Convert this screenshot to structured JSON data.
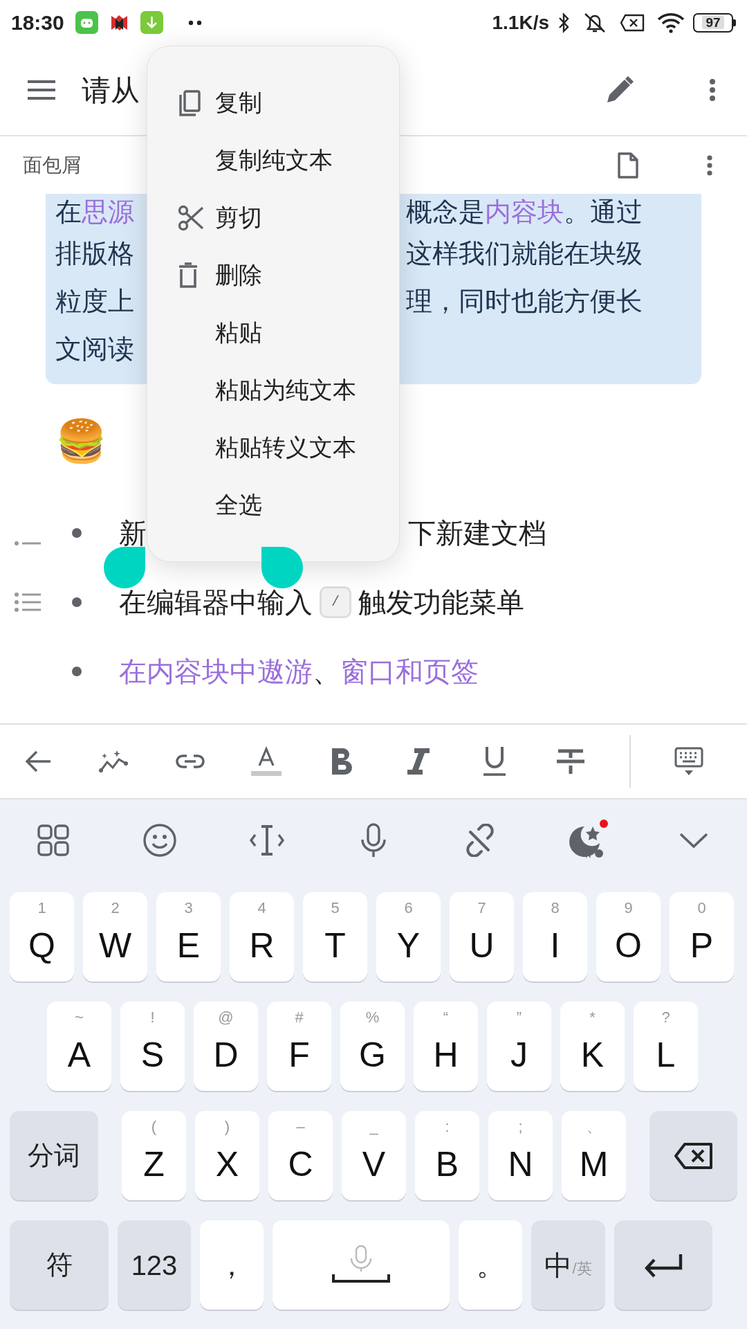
{
  "status_bar": {
    "time": "18:30",
    "net_speed": "1.1K/s",
    "battery": "97"
  },
  "app_bar": {
    "title": "请从"
  },
  "breadcrumb": {
    "label": "面包屑"
  },
  "callout": {
    "lines": [
      {
        "left": [
          {
            "kind": "text",
            "text": "在"
          },
          {
            "kind": "link",
            "text": "思源"
          }
        ],
        "right": [
          {
            "kind": "text",
            "text": "概念是"
          },
          {
            "kind": "link",
            "text": "内容块"
          },
          {
            "kind": "text",
            "text": "。通过"
          }
        ]
      },
      {
        "left": [
          {
            "kind": "text",
            "text": "排版格"
          }
        ],
        "right": [
          {
            "kind": "text",
            "text": "这样我们就能在块级"
          }
        ]
      },
      {
        "left": [
          {
            "kind": "text",
            "text": "粒度上"
          }
        ],
        "right": [
          {
            "kind": "text",
            "text": "理，同时也能方便长"
          }
        ]
      },
      {
        "left": [
          {
            "kind": "text",
            "text": "文阅读"
          }
        ]
      }
    ]
  },
  "heading": {
    "emoji": "🍔"
  },
  "bullets": [
    {
      "left": [
        {
          "kind": "text",
          "text": "新"
        }
      ],
      "right": [
        {
          "kind": "text",
          "text": "下新建文档"
        }
      ]
    },
    {
      "left": [
        {
          "kind": "text",
          "text": "在编辑器中输入"
        },
        {
          "kind": "kbd",
          "text": "/"
        },
        {
          "kind": "text",
          "text": "触发功能菜单"
        }
      ]
    },
    {
      "left": [
        {
          "kind": "link",
          "text": "在内容块中遨游"
        },
        {
          "kind": "text",
          "text": "、"
        },
        {
          "kind": "link",
          "text": "窗口和页签"
        }
      ]
    }
  ],
  "context_menu": [
    {
      "kind": "copy",
      "label": "复制"
    },
    {
      "kind": "plain",
      "label": "复制纯文本"
    },
    {
      "kind": "cut",
      "label": "剪切"
    },
    {
      "kind": "delete",
      "label": "删除"
    },
    {
      "kind": "plain",
      "label": "粘贴"
    },
    {
      "kind": "plain",
      "label": "粘贴为纯文本"
    },
    {
      "kind": "plain",
      "label": "粘贴转义文本"
    },
    {
      "kind": "plain",
      "label": "全选"
    }
  ],
  "keyboard": {
    "rows": [
      [
        {
          "kind": "letter",
          "label": "Q",
          "hint": "1"
        },
        {
          "kind": "letter",
          "label": "W",
          "hint": "2"
        },
        {
          "kind": "letter",
          "label": "E",
          "hint": "3"
        },
        {
          "kind": "letter",
          "label": "R",
          "hint": "4"
        },
        {
          "kind": "letter",
          "label": "T",
          "hint": "5"
        },
        {
          "kind": "letter",
          "label": "Y",
          "hint": "6"
        },
        {
          "kind": "letter",
          "label": "U",
          "hint": "7"
        },
        {
          "kind": "letter",
          "label": "I",
          "hint": "8"
        },
        {
          "kind": "letter",
          "label": "O",
          "hint": "9"
        },
        {
          "kind": "letter",
          "label": "P",
          "hint": "0"
        }
      ],
      [
        {
          "kind": "letter",
          "label": "A",
          "hint": "~"
        },
        {
          "kind": "letter",
          "label": "S",
          "hint": "!"
        },
        {
          "kind": "letter",
          "label": "D",
          "hint": "@"
        },
        {
          "kind": "letter",
          "label": "F",
          "hint": "#"
        },
        {
          "kind": "letter",
          "label": "G",
          "hint": "%"
        },
        {
          "kind": "letter",
          "label": "H",
          "hint": "“"
        },
        {
          "kind": "letter",
          "label": "J",
          "hint": "”"
        },
        {
          "kind": "letter",
          "label": "K",
          "hint": "*"
        },
        {
          "kind": "letter",
          "label": "L",
          "hint": "?"
        }
      ],
      [
        {
          "kind": "function",
          "label": "分词"
        },
        {
          "kind": "letter",
          "label": "Z",
          "hint": "("
        },
        {
          "kind": "letter",
          "label": "X",
          "hint": ")"
        },
        {
          "kind": "letter",
          "label": "C",
          "hint": "–"
        },
        {
          "kind": "letter",
          "label": "V",
          "hint": "_"
        },
        {
          "kind": "letter",
          "label": "B",
          "hint": ":"
        },
        {
          "kind": "letter",
          "label": "N",
          "hint": ";"
        },
        {
          "kind": "letter",
          "label": "M",
          "hint": "、"
        },
        {
          "kind": "backspace"
        }
      ],
      [
        {
          "kind": "function",
          "label": "符"
        },
        {
          "kind": "function",
          "label": "123"
        },
        {
          "kind": "punct",
          "label": "，"
        },
        {
          "kind": "space"
        },
        {
          "kind": "punct",
          "label": "。"
        },
        {
          "kind": "lang",
          "label": "中",
          "hint": "/英"
        },
        {
          "kind": "enter"
        }
      ]
    ]
  }
}
